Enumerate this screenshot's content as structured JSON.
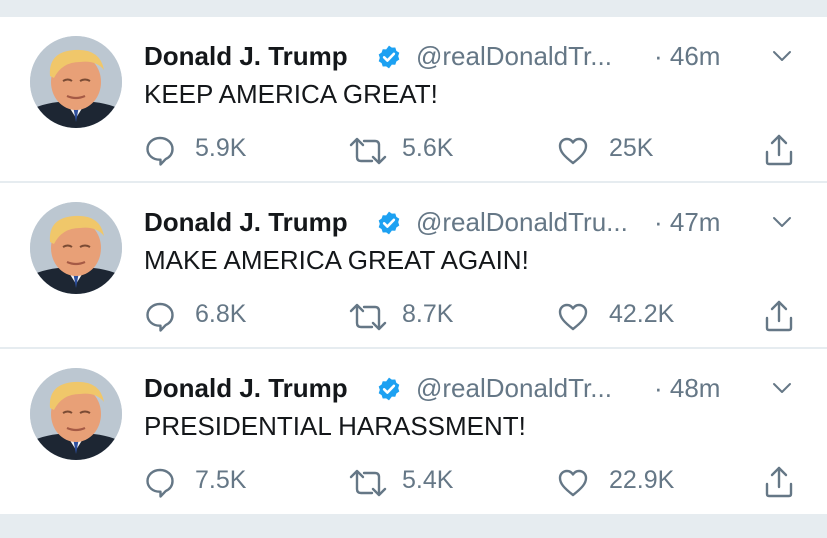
{
  "tweets": [
    {
      "name": "Donald J. Trump",
      "handle": "@realDonaldTr...",
      "time": "· 46m",
      "text": "KEEP AMERICA GREAT!",
      "replies": "5.9K",
      "retweets": "5.6K",
      "likes": "25K"
    },
    {
      "name": "Donald J. Trump",
      "handle": "@realDonaldTru...",
      "time": "· 47m",
      "text": "MAKE AMERICA GREAT AGAIN!",
      "replies": "6.8K",
      "retweets": "8.7K",
      "likes": "42.2K"
    },
    {
      "name": "Donald J. Trump",
      "handle": "@realDonaldTr...",
      "time": "· 48m",
      "text": "PRESIDENTIAL HARASSMENT!",
      "replies": "7.5K",
      "retweets": "5.4K",
      "likes": "22.9K"
    }
  ],
  "icons": {
    "verified": "verified-badge-icon",
    "caret": "chevron-down-icon",
    "reply": "reply-icon",
    "retweet": "retweet-icon",
    "like": "heart-icon",
    "share": "share-icon"
  },
  "colors": {
    "background": "#e6ecf0",
    "card": "#ffffff",
    "primary_text": "#14171a",
    "secondary_text": "#657786",
    "verified_blue": "#1da1f2"
  }
}
